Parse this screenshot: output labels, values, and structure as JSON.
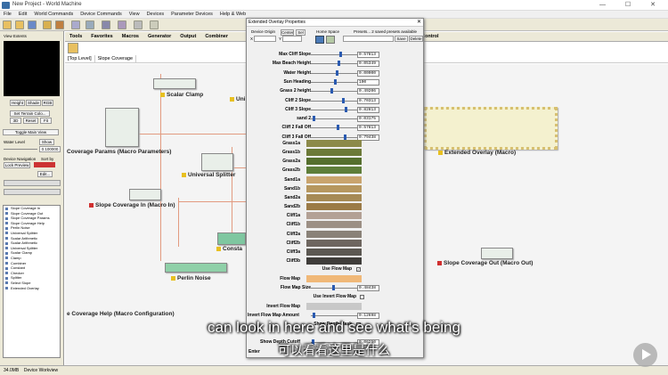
{
  "window": {
    "title": "New Project - World Machine",
    "controls": "— ☐ ✕"
  },
  "menu": [
    "File",
    "Edit",
    "World Commands",
    "Device Commands",
    "View",
    "Devices",
    "Parameter Devices",
    "Help & Web"
  ],
  "tabs": [
    "Tools",
    "Favorites",
    "Macros",
    "Generator",
    "Output",
    "Combiner",
    "Control"
  ],
  "breadcrumb": [
    "[Top Level]",
    "Slope Coverage"
  ],
  "left": {
    "panel_title": "View Extents",
    "btn_height": "Height",
    "btn_shade": "Shade",
    "btn_rgb": "RGB",
    "btn_set_terrain": "Set Terrain Colo...",
    "btn_3d": "3D",
    "btn_reset": "Reset",
    "btn_fit": "Fit",
    "btn_toggle": "Toggle Main View",
    "water_level": "Water Level",
    "water_show": "Show",
    "water_value": "0.100000",
    "device_nav": "Device Navigation",
    "sort_by": "Sort by",
    "lock_preview": "Lock Preview",
    "edit": "Edit..."
  },
  "tree": [
    "Slope Coverage In",
    "Slope Coverage Out",
    "Slope Coverage Params",
    "Slope Coverage Help",
    "Perlin Noise",
    "Universal Splitter",
    "Scalar Arithmetic",
    "Scalar Arithmetic",
    "Universal Splitter",
    "Scalar Clamp",
    "Clamp",
    "Combiner",
    "Constant",
    "Checker",
    "Splitter",
    "Select Slope",
    "Extended Overlay"
  ],
  "nodes": {
    "scalar_clamp": "Scalar Clamp",
    "params": "Coverage Params (Macro Parameters)",
    "splitter": "Universal Splitter",
    "macro_in": "Slope Coverage In (Macro In)",
    "constant": "Consta",
    "perlin": "Perlin Noise",
    "help": "e Coverage Help (Macro Configuration)",
    "overlay": "Extended Overlay (Macro)",
    "macro_out": "Slope Coverage Out (Macro Out)",
    "uni": "Uni"
  },
  "dialog": {
    "title": "Extended Overlay Properties",
    "device_origin": "Device Origin",
    "center": "Center",
    "sel": "Sel",
    "home_space": "Home Space",
    "presets": "Presets... 2 saved presets available",
    "save": "Save",
    "delete": "Delete",
    "x_label": "X",
    "y_label": "Y",
    "sliders": [
      {
        "label": "Max Cliff Slope",
        "value": "0.57813",
        "pos": 0.67
      },
      {
        "label": "Max Beach Height",
        "value": "0.05349",
        "pos": 0.62
      },
      {
        "label": "Water Height",
        "value": "0.00000",
        "pos": 0.58
      },
      {
        "label": "Sun Heading",
        "value": "190",
        "pos": 0.55
      },
      {
        "label": "Grass 2 height",
        "value": "0.49206",
        "pos": 0.45
      },
      {
        "label": "Cliff 2 Slope",
        "value": "0.70313",
        "pos": 0.72
      },
      {
        "label": "Cliff 3 Slope",
        "value": "0.82813",
        "pos": 0.8
      },
      {
        "label": "sand 2",
        "value": "0.03175",
        "pos": 0.05
      },
      {
        "label": "Cliff 2 Fall Off",
        "value": "0.57813",
        "pos": 0.6
      },
      {
        "label": "Cliff 3 Fall Off",
        "value": "0.79438",
        "pos": 0.78
      }
    ],
    "swatches": [
      {
        "label": "Grass1a",
        "color": "#8c8a4a"
      },
      {
        "label": "Grass1b",
        "color": "#6c7a38"
      },
      {
        "label": "Grass2a",
        "color": "#556f2e"
      },
      {
        "label": "Grass2b",
        "color": "#5e7e3a"
      },
      {
        "label": "Sand1a",
        "color": "#c9a46e"
      },
      {
        "label": "Sand1b",
        "color": "#b6975f"
      },
      {
        "label": "Sand2a",
        "color": "#a68a55"
      },
      {
        "label": "Sand2b",
        "color": "#9b7b47"
      },
      {
        "label": "Cliff1a",
        "color": "#b3a195"
      },
      {
        "label": "Cliff1b",
        "color": "#9c8f84"
      },
      {
        "label": "Cliff2a",
        "color": "#8a8278"
      },
      {
        "label": "Cliff2b",
        "color": "#6e665f"
      },
      {
        "label": "Cliff3a",
        "color": "#5c5852"
      },
      {
        "label": "Cliff3b",
        "color": "#3f3d3a"
      }
    ],
    "use_flow_map": "Use Flow Map",
    "flow_map": "Flow Map",
    "flow_map_color": "#f0b878",
    "flow_map_size": "Flow Map Size",
    "flow_map_size_val": "0.48438",
    "use_invert_flow": "Use Invert Flow Map",
    "invert_flow_map": "Invert Flow Map",
    "invert_flow_amount": "Invert Flow Map Amount",
    "invert_flow_amount_val": "0.12698",
    "show_depth_mask": "Show Depth Mask",
    "show_depth_cutoff": "Show Depth Cutoff",
    "show_depth_cutoff_val": "0.06250",
    "enter": "Enter"
  },
  "status": {
    "memory": "34.0MB",
    "mode": "Device Workview"
  },
  "subtitles": {
    "en": "can look in here and see what's being",
    "zh": "可以看看这里是什么"
  }
}
